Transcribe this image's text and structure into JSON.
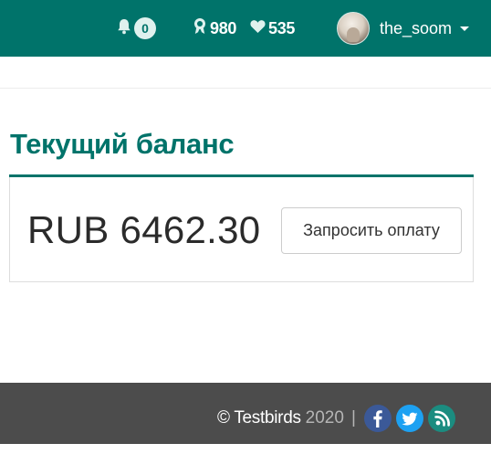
{
  "header": {
    "notifications_count": "0",
    "reputation": "980",
    "likes": "535",
    "username": "the_soom"
  },
  "balance": {
    "title": "Текущий баланс",
    "amount": "RUB 6462.30",
    "request_button_label": "Запросить оплату"
  },
  "footer": {
    "copyright": "© Testbirds",
    "year": "2020",
    "separator": "|",
    "social": [
      "facebook-icon",
      "twitter-icon",
      "blog-icon"
    ]
  },
  "colors": {
    "brand": "#00736a",
    "footer_bg": "#4c4c4c",
    "facebook": "#3b5998",
    "twitter": "#1da1f2"
  }
}
